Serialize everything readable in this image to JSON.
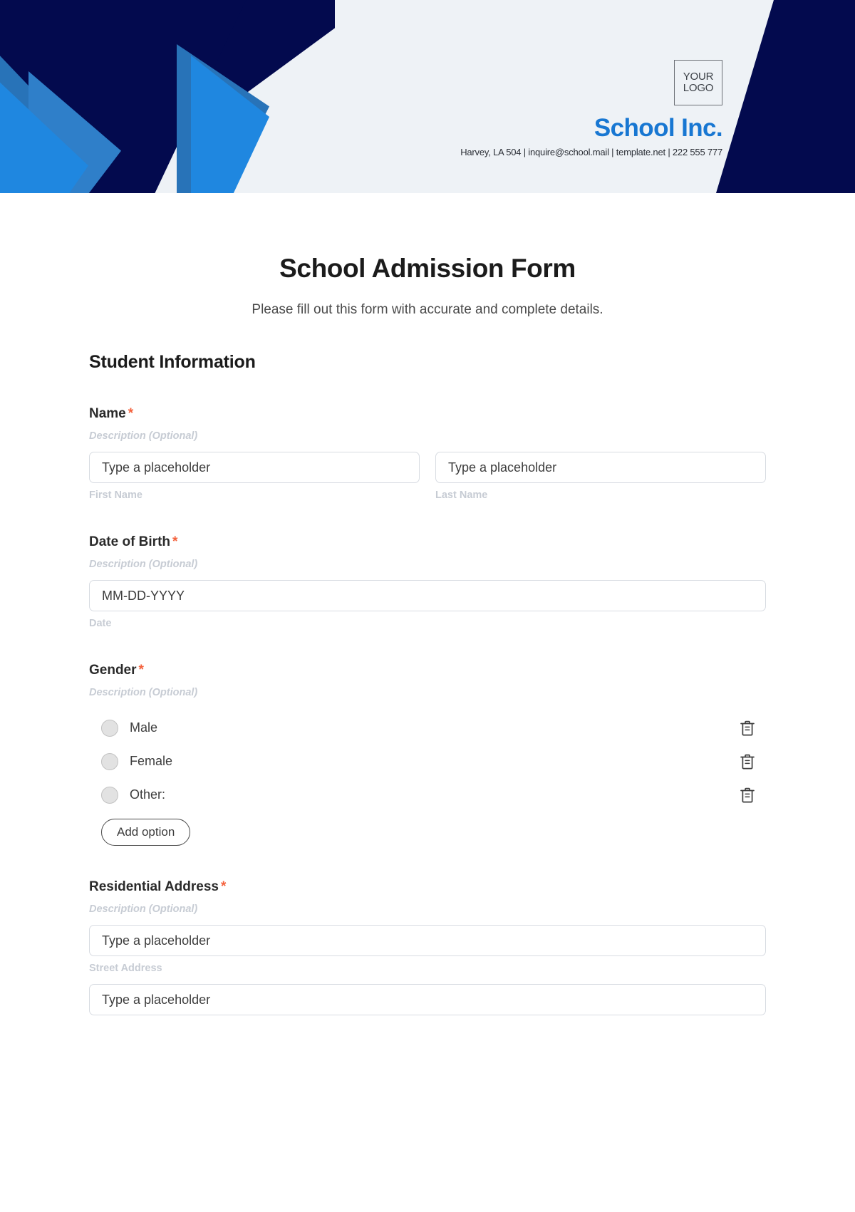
{
  "header": {
    "logo_line1": "YOUR",
    "logo_line2": "LOGO",
    "brand_name": "School Inc.",
    "contact": "Harvey, LA 504 | inquire@school.mail | template.net | 222 555 777",
    "colors": {
      "navy": "#030a4e",
      "blue_mid": "#2873b8",
      "blue_light": "#1f87e0",
      "banner_bg": "#eef2f6",
      "brand_blue": "#1877d2"
    }
  },
  "form": {
    "title": "School Admission Form",
    "subtitle": "Please fill out this form with accurate and complete details.",
    "section_title": "Student Information",
    "required_marker": "*",
    "description_placeholder": "Description (Optional)",
    "fields": {
      "name": {
        "label": "Name",
        "description": "Description (Optional)",
        "first": {
          "placeholder": "Type a placeholder",
          "value": "",
          "sub_label": "First Name"
        },
        "last": {
          "placeholder": "Type a placeholder",
          "value": "",
          "sub_label": "Last Name"
        }
      },
      "dob": {
        "label": "Date of Birth",
        "description": "Description (Optional)",
        "placeholder": "MM-DD-YYYY",
        "value": "",
        "sub_label": "Date"
      },
      "gender": {
        "label": "Gender",
        "description": "Description (Optional)",
        "options": [
          {
            "label": "Male",
            "delete_icon": "trash-icon"
          },
          {
            "label": "Female",
            "delete_icon": "trash-icon"
          },
          {
            "label": "Other:",
            "delete_icon": "trash-icon"
          }
        ],
        "add_option_label": "Add option"
      },
      "address": {
        "label": "Residential Address",
        "description": "Description (Optional)",
        "street": {
          "placeholder": "Type a placeholder",
          "value": "",
          "sub_label": "Street Address"
        },
        "line2": {
          "placeholder": "Type a placeholder",
          "value": ""
        }
      }
    }
  }
}
